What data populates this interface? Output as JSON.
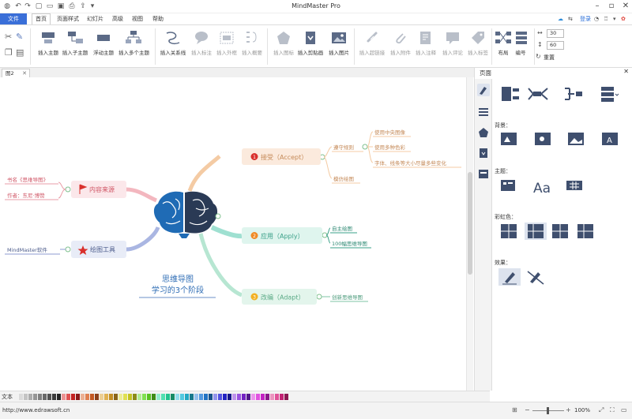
{
  "app": {
    "title": "MindMaster Pro",
    "login_label": "登录"
  },
  "menu": {
    "file": "文件",
    "tabs": [
      "首页",
      "页面样式",
      "幻灯片",
      "高级",
      "视图",
      "帮助"
    ],
    "active_tab": "首页"
  },
  "ribbon": {
    "buttons": [
      {
        "label": "插入主题",
        "icon": "insert-topic-icon",
        "enabled": true
      },
      {
        "label": "插入子主题",
        "icon": "insert-subtopic-icon",
        "enabled": true
      },
      {
        "label": "浮动主题",
        "icon": "floating-topic-icon",
        "enabled": true
      },
      {
        "label": "插入多个主题",
        "icon": "insert-multiple-topics-icon",
        "enabled": true
      },
      {
        "label": "插入关系线",
        "icon": "relationship-line-icon",
        "enabled": true
      },
      {
        "label": "插入标注",
        "icon": "callout-icon",
        "enabled": false
      },
      {
        "label": "插入外框",
        "icon": "boundary-icon",
        "enabled": false
      },
      {
        "label": "插入概要",
        "icon": "summary-icon",
        "enabled": false
      },
      {
        "label": "插入图标",
        "icon": "insert-icon-icon",
        "enabled": false
      },
      {
        "label": "插入剪贴画",
        "icon": "clipart-icon",
        "enabled": true
      },
      {
        "label": "插入图片",
        "icon": "insert-image-icon",
        "enabled": true
      },
      {
        "label": "插入超链接",
        "icon": "hyperlink-icon",
        "enabled": false
      },
      {
        "label": "插入附件",
        "icon": "attachment-icon",
        "enabled": false
      },
      {
        "label": "插入注释",
        "icon": "note-icon",
        "enabled": false
      },
      {
        "label": "插入评论",
        "icon": "comment-icon",
        "enabled": false
      },
      {
        "label": "插入标签",
        "icon": "tag-icon",
        "enabled": false
      },
      {
        "label": "布局",
        "icon": "layout-icon",
        "enabled": true
      },
      {
        "label": "编号",
        "icon": "numbering-icon",
        "enabled": true
      }
    ],
    "spin_width": "30",
    "spin_height": "60",
    "reset_label": "重置"
  },
  "document": {
    "tab_label": "图2"
  },
  "mindmap": {
    "central_title_line1": "思维导图",
    "central_title_line2": "学习的3个阶段",
    "left_branches": [
      {
        "label": "内容来源",
        "marker": "flag-icon",
        "color": "#f3b7bf",
        "children": [
          "书名《思维导图》",
          "作者：东尼·博赞"
        ]
      },
      {
        "label": "绘图工具",
        "marker": "star-icon",
        "color": "#aab6e2",
        "children": [
          "MindMaster软件"
        ]
      }
    ],
    "right_branches": [
      {
        "label": "接受（Accept）",
        "number": "1",
        "color": "#f4cba4",
        "number_color": "#d9302c",
        "children": [
          {
            "label": "遵守规则",
            "children": [
              "使用中央图像",
              "使用多种色彩",
              "字体、线条等大小尽量多些变化"
            ]
          },
          {
            "label": "模仿绘图",
            "children": []
          }
        ]
      },
      {
        "label": "应用（Apply）",
        "number": "2",
        "color": "#9fe0d1",
        "number_color": "#f08a24",
        "children": [
          {
            "label": "自主绘图",
            "children": []
          },
          {
            "label": "100幅思维导图",
            "children": []
          }
        ]
      },
      {
        "label": "改编（Adapt）",
        "number": "3",
        "color": "#b7e6d2",
        "number_color": "#f3b021",
        "children": [
          {
            "label": "创新思维导图",
            "children": []
          }
        ]
      }
    ]
  },
  "panel": {
    "title": "页面",
    "sections": [
      "背景：",
      "主题：",
      "彩虹色：",
      "效果："
    ]
  },
  "status": {
    "url": "http://www.edrawsoft.cn",
    "zoom": "100%"
  },
  "colors": {
    "accent": "#3a6fd8",
    "brain_left": "#1f6bb5",
    "brain_right": "#2a3a55"
  }
}
